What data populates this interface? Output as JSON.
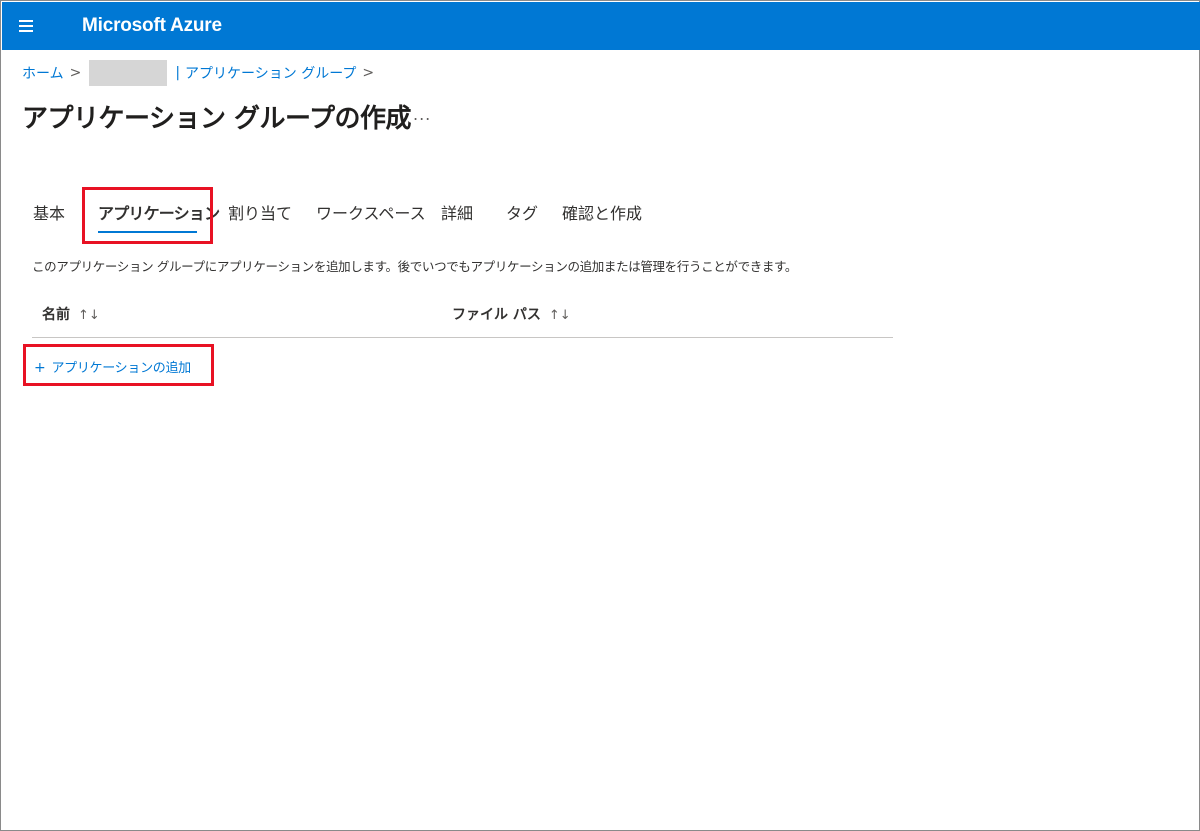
{
  "header": {
    "brand": "Microsoft Azure",
    "accent_color": "#0078d4",
    "menu_icon": "hamburger-icon"
  },
  "breadcrumb": {
    "home": "ホーム",
    "separator": ">",
    "current_prefix": "|",
    "current": "アプリケーション グループ"
  },
  "page": {
    "title": "アプリケーション グループの作成",
    "more_label": "..."
  },
  "tabs": [
    {
      "label": "基本",
      "active": false
    },
    {
      "label": "アプリケーション",
      "active": true
    },
    {
      "label": "割り当て",
      "active": false
    },
    {
      "label": "ワークスペース",
      "active": false
    },
    {
      "label": "詳細",
      "active": false
    },
    {
      "label": "タグ",
      "active": false
    },
    {
      "label": "確認と作成",
      "active": false
    }
  ],
  "description": "このアプリケーション グループにアプリケーションを追加します。後でいつでもアプリケーションの追加または管理を行うことができます。",
  "table": {
    "columns": [
      {
        "label": "名前",
        "sort_icon": "↑↓"
      },
      {
        "label": "ファイル パス",
        "sort_icon": "↑↓"
      }
    ]
  },
  "actions": {
    "add_application": "アプリケーションの追加",
    "add_icon": "+"
  },
  "highlight_color": "#e81123"
}
